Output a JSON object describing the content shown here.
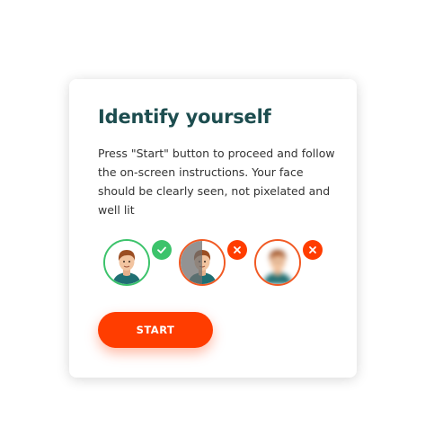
{
  "card": {
    "title": "Identify yourself",
    "description": "Press \"Start\" button to proceed and follow the on-screen instructions. Your face should be clearly seen, not pixelated and well lit"
  },
  "examples": [
    {
      "icon": "face-clear-icon",
      "status": "check-icon",
      "status_color": "#3cc36b"
    },
    {
      "icon": "face-shadowed-icon",
      "status": "cross-icon",
      "status_color": "#ff3d00"
    },
    {
      "icon": "face-blurred-icon",
      "status": "cross-icon",
      "status_color": "#ff3d00"
    }
  ],
  "start_button": {
    "label": "START"
  },
  "colors": {
    "accent": "#ff3d00",
    "title": "#1d4d4f",
    "success": "#3cc36b"
  }
}
